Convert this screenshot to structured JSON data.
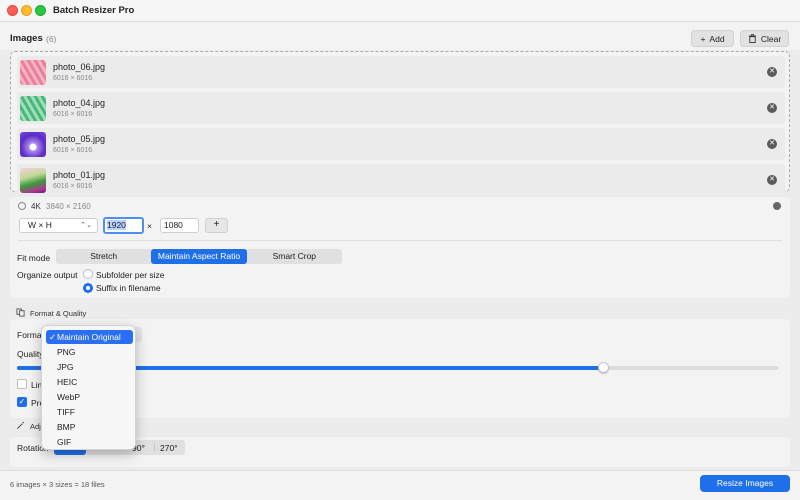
{
  "app": {
    "title": "Batch Resizer Pro"
  },
  "images_section": {
    "label": "Images",
    "count": "(6)",
    "add_label": "Add",
    "clear_label": "Clear",
    "files": [
      {
        "name": "photo_06.jpg",
        "dimensions": "6016 × 6016"
      },
      {
        "name": "photo_04.jpg",
        "dimensions": "6016 × 6016"
      },
      {
        "name": "photo_05.jpg",
        "dimensions": "6016 × 6016"
      },
      {
        "name": "photo_01.jpg",
        "dimensions": "6016 × 6016"
      }
    ]
  },
  "size_preset": {
    "name": "4K",
    "dimensions": "3840 × 2160",
    "mode_select": "W × H",
    "width_value": "1920",
    "times": "×",
    "height_value": "1080",
    "add_symbol": "+"
  },
  "fit_mode": {
    "label": "Fit mode",
    "options": [
      "Stretch",
      "Maintain Aspect Ratio",
      "Smart Crop"
    ],
    "selected": "Maintain Aspect Ratio"
  },
  "organize_output": {
    "label": "Organize output",
    "options": [
      "Subfolder per size",
      "Suffix in filename"
    ],
    "selected": "Suffix in filename"
  },
  "format_quality": {
    "header": "Format & Quality",
    "format_label": "Forma",
    "quality_label": "Quality",
    "quality_fraction": 0.77,
    "limit_label": "Lim",
    "limit_checked": false,
    "preserve_label": "Pre",
    "preserve_checked": true
  },
  "format_dropdown": {
    "selected": "Maintain Original",
    "options": [
      "Maintain Original",
      "PNG",
      "JPG",
      "HEIC",
      "WebP",
      "TIFF",
      "BMP",
      "GIF"
    ]
  },
  "adjustments": {
    "header": "Adj",
    "rotation_label": "Rotation",
    "rotation_visible": [
      "90°",
      "270°"
    ]
  },
  "footer": {
    "summary": "6 images × 3 sizes = 18 files",
    "resize_label": "Resize Images"
  },
  "colors": {
    "accent": "#1f6fe8"
  }
}
